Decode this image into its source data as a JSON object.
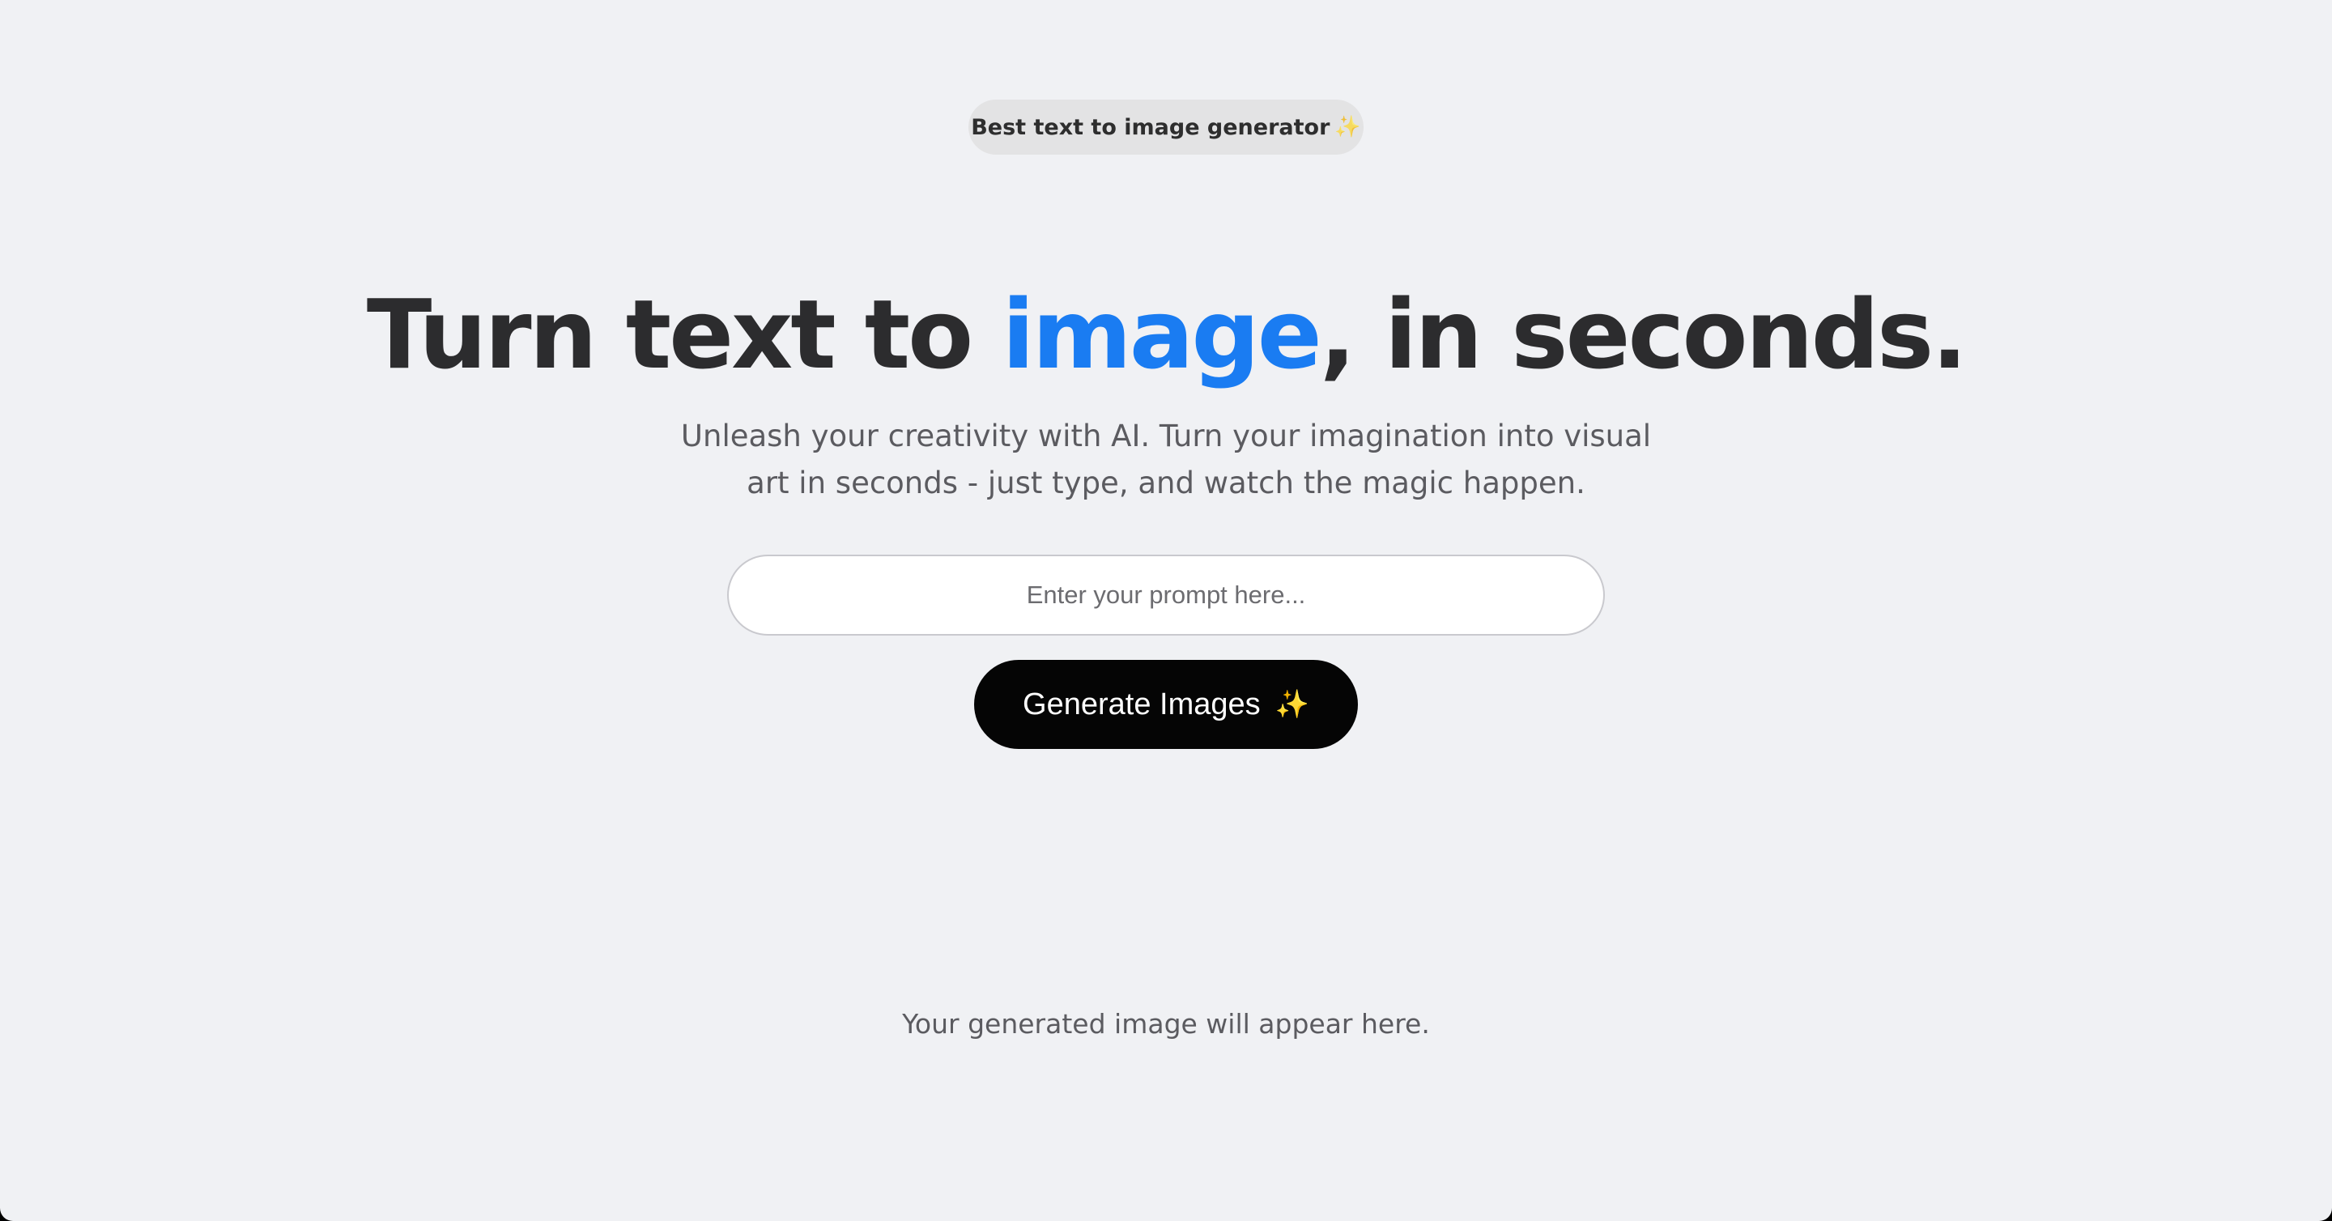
{
  "badge": {
    "label": "Best text to image generator",
    "icon": "✨"
  },
  "hero": {
    "title_before": "Turn text to ",
    "title_accent": "image",
    "title_after": ", in seconds.",
    "subtitle": "Unleash your creativity with AI. Turn your imagination into visual art in seconds - just type, and watch the magic happen."
  },
  "prompt": {
    "placeholder": "Enter your prompt here...",
    "value": ""
  },
  "generate": {
    "label": "Generate Images",
    "icon": "✨"
  },
  "result": {
    "placeholder_text": "Your generated image will appear here."
  },
  "colors": {
    "background": "#f0f1f4",
    "accent": "#1a7cf2",
    "button_bg": "#050505",
    "badge_bg": "#e3e3e4"
  }
}
